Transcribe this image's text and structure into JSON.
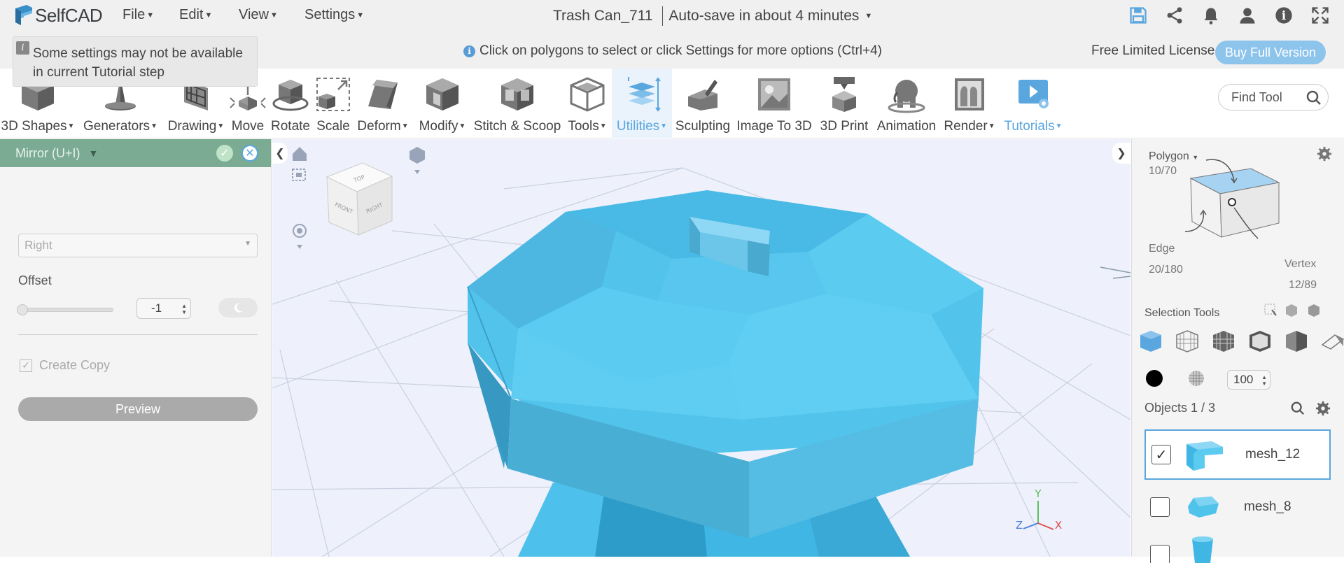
{
  "app": {
    "brand": "SelfCAD"
  },
  "menus": [
    {
      "label": "File"
    },
    {
      "label": "Edit"
    },
    {
      "label": "View"
    },
    {
      "label": "Settings"
    }
  ],
  "document": {
    "title": "Trash Can_711",
    "autosave": "Auto-save in about 4 minutes"
  },
  "hint": {
    "text": "Click on polygons to select or click Settings for more options (Ctrl+4)"
  },
  "license": {
    "label": "Free Limited License",
    "buy": "Buy Full Version"
  },
  "ribbon": [
    {
      "label": "3D Shapes",
      "dropdown": true
    },
    {
      "label": "Generators",
      "dropdown": true
    },
    {
      "label": "Drawing",
      "dropdown": true
    },
    {
      "label": "Move"
    },
    {
      "label": "Rotate"
    },
    {
      "label": "Scale"
    },
    {
      "label": "Deform",
      "dropdown": true
    },
    {
      "label": "Modify",
      "dropdown": true
    },
    {
      "label": "Stitch & Scoop"
    },
    {
      "label": "Tools",
      "dropdown": true
    },
    {
      "label": "Utilities",
      "dropdown": true,
      "active": true
    },
    {
      "label": "Sculpting"
    },
    {
      "label": "Image To 3D"
    },
    {
      "label": "3D Print"
    },
    {
      "label": "Animation"
    },
    {
      "label": "Render",
      "dropdown": true
    },
    {
      "label": "Tutorials",
      "dropdown": true
    }
  ],
  "find_tool": {
    "placeholder": "Find Tool"
  },
  "panel": {
    "title": "Mirror (U+I)",
    "notice": "Some settings may not be available in current Tutorial step",
    "direction": "Right",
    "offset_label": "Offset",
    "offset_value": "-1",
    "create_copy_label": "Create Copy",
    "create_copy_checked": true,
    "preview_label": "Preview"
  },
  "cube": {
    "front": "FRONT",
    "right": "RIGHT",
    "top": "TOP"
  },
  "axes": {
    "x": "X",
    "y": "Y",
    "z": "Z"
  },
  "selection": {
    "polygon_label": "Polygon",
    "polygon_count": "10/70",
    "edge_label": "Edge",
    "edge_count": "20/180",
    "vertex_label": "Vertex",
    "vertex_count": "12/89",
    "tools_label": "Selection Tools",
    "opacity": "100"
  },
  "objects": {
    "header": "Objects 1 / 3",
    "items": [
      {
        "name": "mesh_12",
        "checked": true,
        "selected": true
      },
      {
        "name": "mesh_8",
        "checked": false,
        "selected": false
      }
    ]
  },
  "colors": {
    "accent": "#5aa6de",
    "panel_header": "#7bab92",
    "mesh": "#4fc3ea",
    "buy_button": "#8dc4ec"
  }
}
